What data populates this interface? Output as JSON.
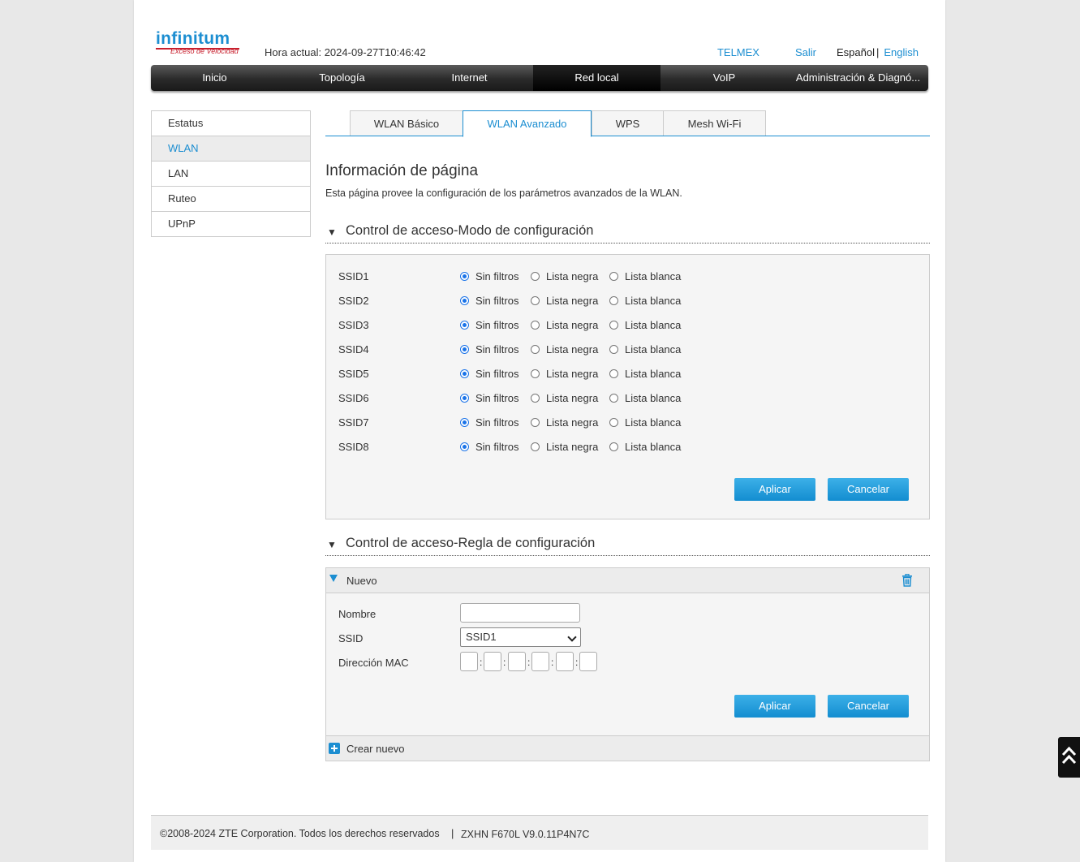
{
  "header": {
    "logo_brand": "infinitum",
    "logo_tagline": "Exceso de Velocidad",
    "current_time": "Hora actual: 2024-09-27T10:46:42",
    "links": {
      "telmex": "TELMEX",
      "logout": "Salir",
      "spanish": "Español",
      "separator": "|",
      "english": "English"
    }
  },
  "nav": {
    "items": [
      "Inicio",
      "Topología",
      "Internet",
      "Red local",
      "VoIP",
      "Administración & Diagnó..."
    ],
    "active": "Red local"
  },
  "sidebar": {
    "items": [
      "Estatus",
      "WLAN",
      "LAN",
      "Ruteo",
      "UPnP"
    ],
    "active": "WLAN"
  },
  "tabs": {
    "items": [
      "WLAN Básico",
      "WLAN Avanzado",
      "WPS",
      "Mesh Wi-Fi"
    ],
    "active": "WLAN Avanzado"
  },
  "info": {
    "title": "Información de página",
    "description": "Esta página provee la configuración de los parámetros avanzados de la WLAN."
  },
  "mode_section": {
    "title": "Control de acceso-Modo de configuración",
    "options": [
      "Sin filtros",
      "Lista negra",
      "Lista blanca"
    ],
    "rows": [
      {
        "ssid": "SSID1",
        "selected": "Sin filtros"
      },
      {
        "ssid": "SSID2",
        "selected": "Sin filtros"
      },
      {
        "ssid": "SSID3",
        "selected": "Sin filtros"
      },
      {
        "ssid": "SSID4",
        "selected": "Sin filtros"
      },
      {
        "ssid": "SSID5",
        "selected": "Sin filtros"
      },
      {
        "ssid": "SSID6",
        "selected": "Sin filtros"
      },
      {
        "ssid": "SSID7",
        "selected": "Sin filtros"
      },
      {
        "ssid": "SSID8",
        "selected": "Sin filtros"
      }
    ],
    "apply_label": "Aplicar",
    "cancel_label": "Cancelar"
  },
  "rule_section": {
    "title": "Control de acceso-Regla de configuración",
    "entry_title": "Nuevo",
    "name_label": "Nombre",
    "name_value": "",
    "ssid_label": "SSID",
    "ssid_value": "SSID1",
    "mac_label": "Dirección MAC",
    "mac_value": [
      "",
      "",
      "",
      "",
      "",
      ""
    ],
    "apply_label": "Aplicar",
    "cancel_label": "Cancelar",
    "create_label": "Crear nuevo"
  },
  "footer": {
    "copyright": "©2008-2024 ZTE Corporation. Todos los derechos reservados",
    "separator": "|",
    "version": "ZXHN F670L V9.0.11P4N7C"
  },
  "icons": {
    "trash": "trash-icon",
    "plus": "plus-icon",
    "scroll_top": "double-chevron-up-icon"
  },
  "colors": {
    "accent": "#1c8ed1",
    "brand_red": "#c8202e",
    "nav_dark": "#1a1a1a"
  }
}
